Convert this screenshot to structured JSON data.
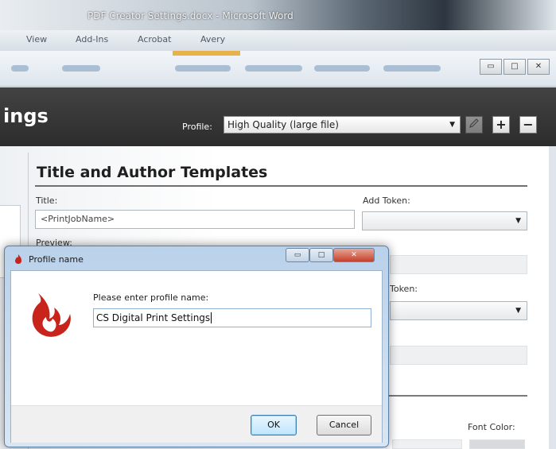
{
  "word": {
    "title": "PDF Creator Settings.docx - Microsoft Word",
    "menu": [
      "View",
      "Add-Ins",
      "Acrobat",
      "Avery"
    ]
  },
  "settings": {
    "title_partial": "ings",
    "profile_label": "Profile:",
    "profile_value": "High Quality (large file)",
    "section_title": "Title and Author Templates",
    "title_label": "Title:",
    "title_value": "<PrintJobName>",
    "add_token_label": "Add Token:",
    "preview_label": "Preview:",
    "token_label_partial": "Token:",
    "font_color_label": "Font Color:"
  },
  "dialog": {
    "title": "Profile name",
    "prompt": "Please enter profile name:",
    "input_value": "CS Digital Print Settings",
    "ok_label": "OK",
    "cancel_label": "Cancel"
  },
  "colors": {
    "header_bg": "#333333",
    "flame_red": "#c8241c",
    "dialog_frame": "#b9d1ea"
  },
  "icons": [
    "flame-icon",
    "pencil-icon",
    "plus-icon",
    "minus-icon",
    "close-icon",
    "chevron-down-icon"
  ]
}
